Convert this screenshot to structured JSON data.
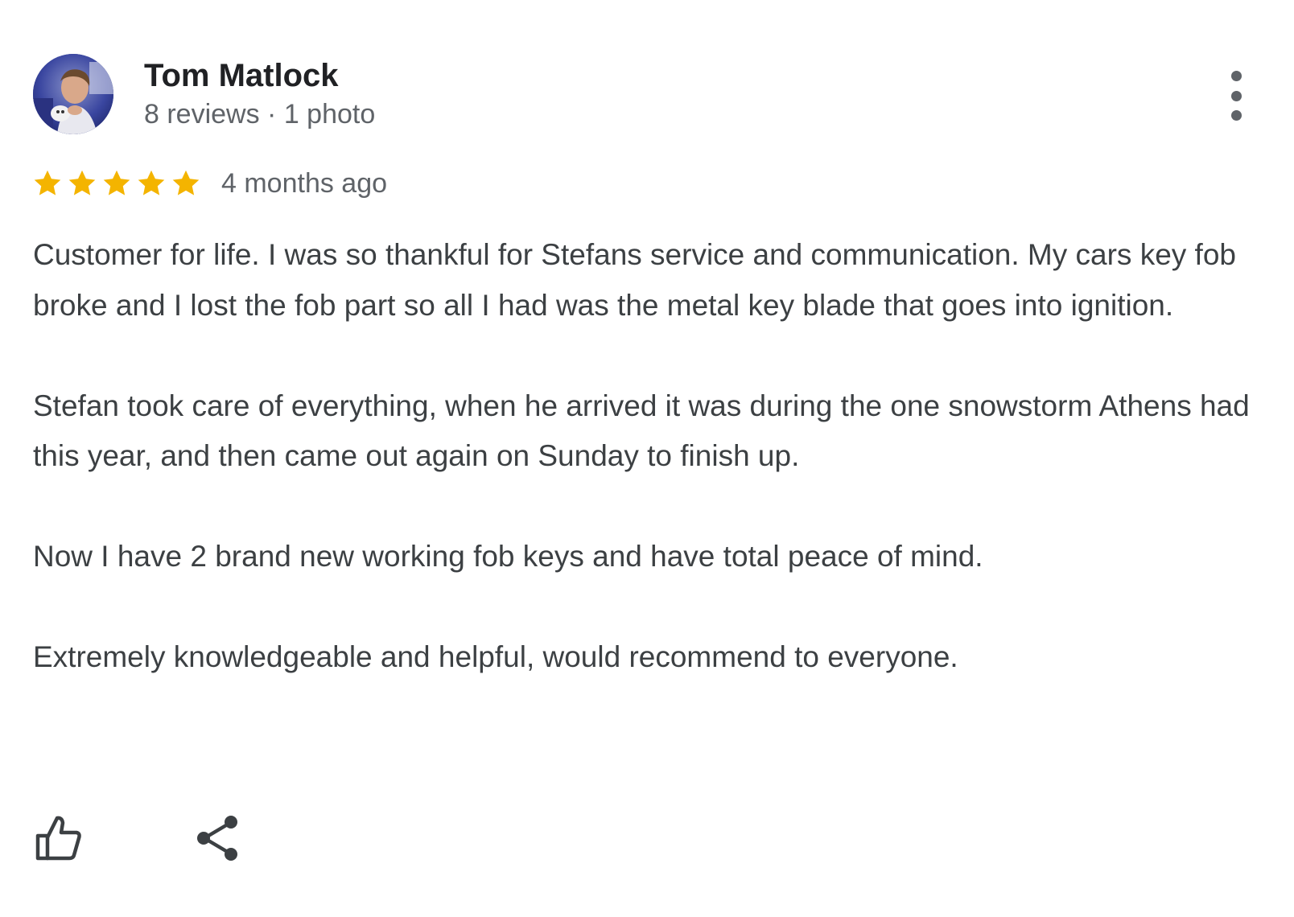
{
  "reviewer": {
    "name": "Tom Matlock",
    "meta": "8 reviews · 1 photo",
    "avatar_icon": "user-photo-avatar"
  },
  "menu": {
    "icon": "more-vert-icon"
  },
  "rating": {
    "value": 5,
    "max": 5,
    "star_color": "#f4b400",
    "date": "4 months ago"
  },
  "review": {
    "paragraphs": [
      "Customer for life. I was so thankful for Stefans service and communication. My cars key fob broke and I lost the fob part so all I had was the metal key blade that goes into ignition.",
      "Stefan took care of everything, when he arrived it was during the one snowstorm Athens had this year, and then came out again on Sunday to finish up.",
      "Now I have 2 brand new working fob keys and have total peace of mind.",
      "Extremely knowledgeable and helpful, would recommend to everyone."
    ]
  },
  "actions": {
    "like_icon": "thumb-up-icon",
    "share_icon": "share-icon"
  },
  "colors": {
    "text_primary": "#202124",
    "text_secondary": "#5f6368",
    "text_body": "#3c4043"
  }
}
